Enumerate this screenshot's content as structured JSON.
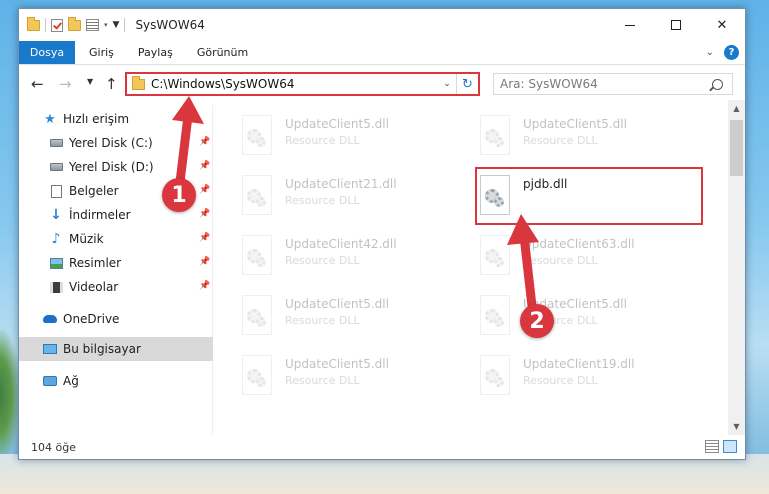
{
  "window": {
    "title": "SysWOW64"
  },
  "ribbon": {
    "tabs": [
      "Dosya",
      "Giriş",
      "Paylaş",
      "Görünüm"
    ],
    "help": "?"
  },
  "address": {
    "path": "C:\\Windows\\SysWOW64",
    "search_placeholder": "Ara: SysWOW64"
  },
  "sidebar": {
    "items": [
      {
        "label": "Hızlı erişim",
        "icon": "star-icon",
        "pinned": false
      },
      {
        "label": "Yerel Disk (C:)",
        "icon": "disk-icon",
        "pinned": true
      },
      {
        "label": "Yerel Disk (D:)",
        "icon": "disk-icon",
        "pinned": true
      },
      {
        "label": "Belgeler",
        "icon": "documents-icon",
        "pinned": true
      },
      {
        "label": "İndirmeler",
        "icon": "download-icon",
        "pinned": true
      },
      {
        "label": "Müzik",
        "icon": "music-icon",
        "pinned": true
      },
      {
        "label": "Resimler",
        "icon": "pictures-icon",
        "pinned": true
      },
      {
        "label": "Videolar",
        "icon": "videos-icon",
        "pinned": true
      },
      {
        "label": "OneDrive",
        "icon": "cloud-icon",
        "pinned": false
      },
      {
        "label": "Bu bilgisayar",
        "icon": "computer-icon",
        "pinned": false,
        "selected": true
      },
      {
        "label": "Ağ",
        "icon": "network-icon",
        "pinned": false
      }
    ]
  },
  "files": [
    {
      "name": "UpdateClient5.dll",
      "type": "Resource DLL",
      "faded": true
    },
    {
      "name": "UpdateClient5.dll",
      "type": "Resource DLL",
      "faded": true
    },
    {
      "name": "UpdateClient21.dll",
      "type": "Resource DLL",
      "faded": true
    },
    {
      "name": "pjdb.dll",
      "type": "",
      "faded": false,
      "highlighted": true
    },
    {
      "name": "UpdateClient42.dll",
      "type": "Resource DLL",
      "faded": true
    },
    {
      "name": "UpdateClient63.dll",
      "type": "Resource DLL",
      "faded": true
    },
    {
      "name": "UpdateClient5.dll",
      "type": "Resource DLL",
      "faded": true
    },
    {
      "name": "UpdateClient5.dll",
      "type": "Resource DLL",
      "faded": true
    },
    {
      "name": "UpdateClient5.dll",
      "type": "Resource DLL",
      "faded": true
    },
    {
      "name": "UpdateClient19.dll",
      "type": "Resource DLL",
      "faded": true
    }
  ],
  "status": {
    "count": "104 öğe"
  },
  "annotations": {
    "step1": "1",
    "step2": "2",
    "color": "#d9363e"
  }
}
